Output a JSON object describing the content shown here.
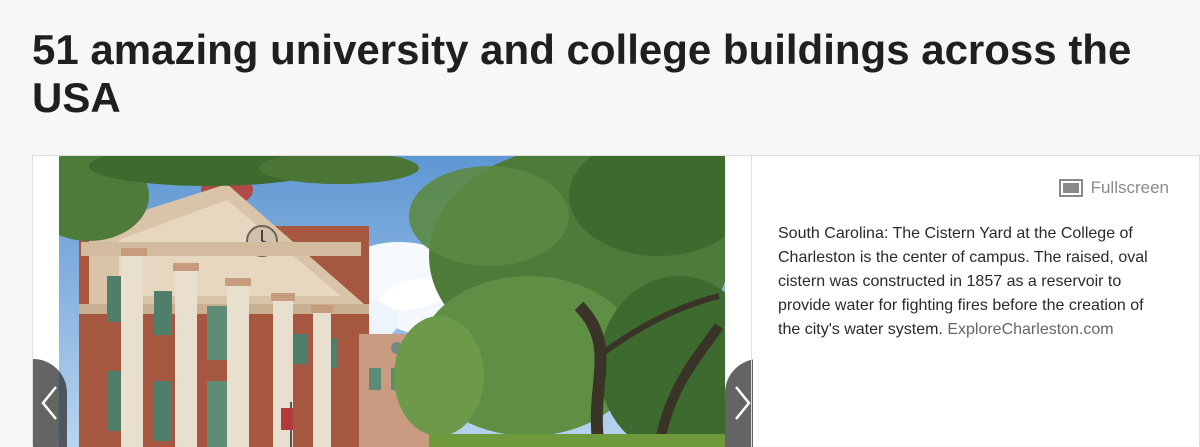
{
  "article": {
    "title": "51 amazing university and college buildings across the USA"
  },
  "gallery": {
    "fullscreen_label": "Fullscreen",
    "prev_icon": "chevron-left-icon",
    "next_icon": "chevron-right-icon",
    "caption": "South Carolina: The Cistern Yard at the College of Charleston is the center of campus. The raised, oval cistern was constructed in 1857 as a reservoir to provide water for fighting fires before the creation of the city's water system.",
    "source": "ExploreCharleston.com"
  },
  "colors": {
    "page_bg": "#f7f7f7",
    "nav_button": "#282828",
    "brick": "#a5583f",
    "sky": "#7fb0de"
  }
}
